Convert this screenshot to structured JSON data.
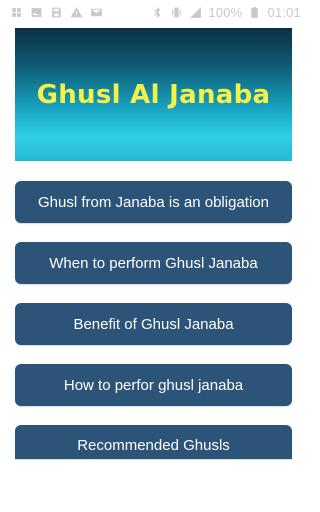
{
  "status_bar": {
    "battery_percent": "100%",
    "time": "01:01",
    "icons": [
      "app-notification-icon",
      "gallery-icon",
      "save-icon",
      "warning-icon",
      "mail-icon",
      "bluetooth-icon",
      "vibrate-icon",
      "signal-icon",
      "battery-icon"
    ]
  },
  "banner": {
    "title": "Ghusl Al Janaba"
  },
  "menu": {
    "items": [
      {
        "label": "Ghusl from Janaba is an obligation"
      },
      {
        "label": "When to perform Ghusl Janaba"
      },
      {
        "label": "Benefit of Ghusl Janaba"
      },
      {
        "label": "How to perfor ghusl janaba"
      },
      {
        "label": "Recommended Ghusls"
      }
    ]
  },
  "colors": {
    "button_bg": "#2c5479",
    "button_text": "#ffffff",
    "banner_text": "#f4f14a",
    "banner_accent": "#2fd0ea"
  }
}
